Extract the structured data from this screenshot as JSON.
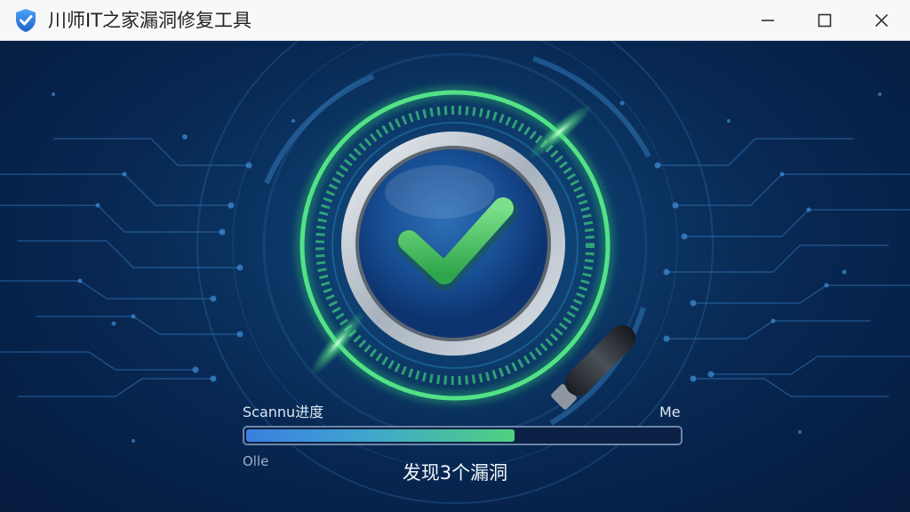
{
  "window": {
    "title": "川师IT之家漏洞修复工具",
    "app_icon": "shield-check-icon",
    "controls": {
      "minimize_icon": "minimize-icon",
      "maximize_icon": "maximize-icon",
      "close_icon": "close-icon"
    }
  },
  "scan": {
    "label_left": "Scannu进度",
    "label_right": "Me",
    "below_left": "Olle",
    "progress": 0.62,
    "result": "发现3个漏洞",
    "icon": "magnifier-check-icon"
  },
  "colors": {
    "background": "#072650",
    "accent_green": "#4fd17f",
    "accent_blue": "#3a7ee0",
    "titlebar": "#f7f8fa"
  }
}
